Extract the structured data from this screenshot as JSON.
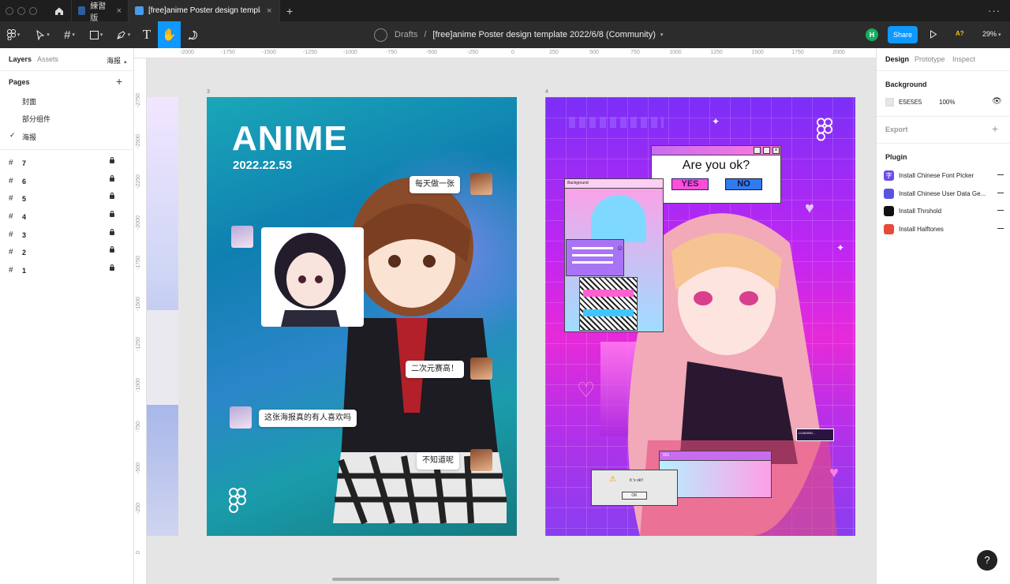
{
  "tabs": [
    {
      "label": "練習版"
    },
    {
      "label": "[free]anime Poster design template ..."
    }
  ],
  "toolbar": {
    "breadcrumb_root": "Drafts",
    "breadcrumb_sep": "/",
    "file_title": "[free]anime Poster design template 2022/6/8 (Community)",
    "user_initial": "H",
    "share_label": "Share",
    "a11y_label": "A?",
    "zoom": "29%"
  },
  "left": {
    "tab_layers": "Layers",
    "tab_assets": "Assets",
    "page_selector": "海报",
    "pages_title": "Pages",
    "pages": [
      "封面",
      "部分组件",
      "海报"
    ],
    "layers": [
      "7",
      "6",
      "5",
      "4",
      "3",
      "2",
      "1"
    ]
  },
  "ruler": {
    "top": [
      "-2000",
      "-1750",
      "-1500",
      "-1250",
      "-1000",
      "-750",
      "-500",
      "-250",
      "0",
      "250",
      "500",
      "750",
      "1000",
      "1250",
      "1500",
      "1750",
      "2000"
    ],
    "left": [
      "-2750",
      "-2500",
      "-2250",
      "-2000",
      "-1750",
      "-1500",
      "-1250",
      "-1000",
      "-750",
      "-500",
      "-250",
      "0"
    ]
  },
  "canvas": {
    "frame3_label": "3",
    "frame4_label": "4",
    "poster1": {
      "title": "ANIME",
      "date": "2022.22.53",
      "bubbles": [
        "每天做一张",
        "二次元赛高！",
        "这张海报真的有人喜欢吗",
        "不知道呢"
      ]
    },
    "poster2": {
      "question": "Are you ok?",
      "yes": "YES",
      "no": "NO",
      "bg_window": "Background",
      "loading": "LOADING...",
      "small_window": "001",
      "dialog_text": "It 's ok!!",
      "dialog_ok": "OK"
    }
  },
  "right": {
    "tab_design": "Design",
    "tab_prototype": "Prototype",
    "tab_inspect": "Inspect",
    "background_title": "Background",
    "bg_hex": "E5E5E5",
    "bg_opacity": "100%",
    "export_title": "Export",
    "plugin_title": "Plugin",
    "plugins": [
      {
        "name": "Install Chinese Font Picker",
        "color": "#6b4ce6"
      },
      {
        "name": "Install Chinese User Data Ge...",
        "color": "#5a53e0"
      },
      {
        "name": "Install Thrshold",
        "color": "#111111"
      },
      {
        "name": "Install Halftones",
        "color": "#e84a3c"
      }
    ]
  },
  "help_label": "?"
}
